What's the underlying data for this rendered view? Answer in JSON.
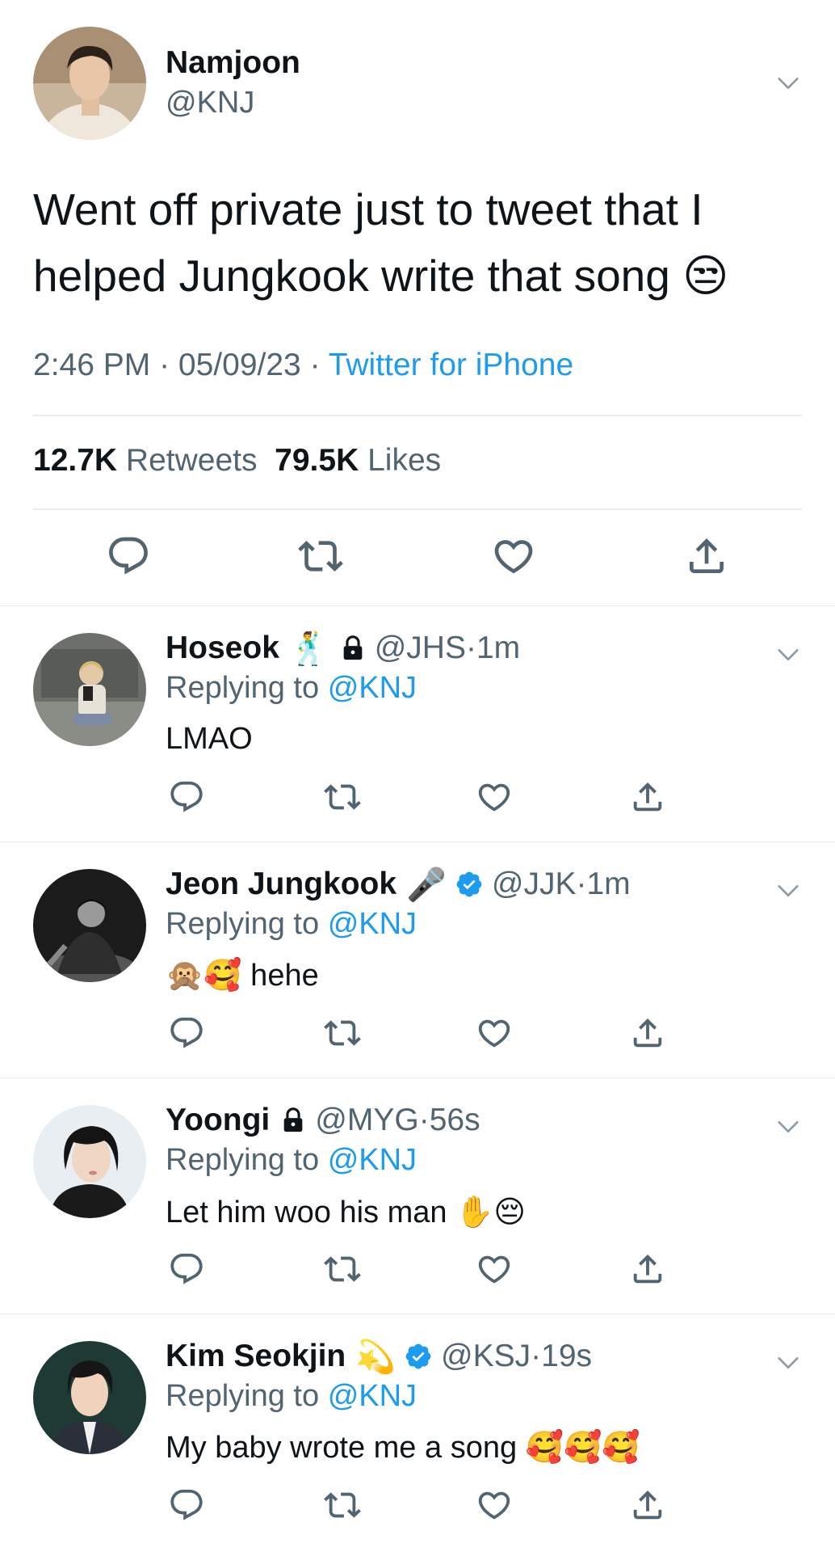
{
  "main_tweet": {
    "name": "Namjoon",
    "handle": "@KNJ",
    "text": "Went off private just to tweet that I helped Jungkook write that song 😒",
    "time": "2:46 PM",
    "date": "05/09/23",
    "source": "Twitter for iPhone",
    "retweets_count": "12.7K",
    "retweets_label": "Retweets",
    "likes_count": "79.5K",
    "likes_label": "Likes"
  },
  "replies": [
    {
      "name": "Hoseok",
      "name_emoji": "🕺",
      "locked": true,
      "verified": false,
      "handle": "@JHS",
      "time": "1m",
      "replying_prefix": "Replying to",
      "replying_to": "@KNJ",
      "text": "LMAO"
    },
    {
      "name": "Jeon Jungkook",
      "name_emoji": "🎤",
      "locked": false,
      "verified": true,
      "handle": "@JJK",
      "time": "1m",
      "replying_prefix": "Replying to",
      "replying_to": "@KNJ",
      "text": "🙊🥰 hehe"
    },
    {
      "name": "Yoongi",
      "name_emoji": "",
      "locked": true,
      "verified": false,
      "handle": "@MYG",
      "time": "56s",
      "replying_prefix": "Replying to",
      "replying_to": "@KNJ",
      "text": "Let him woo his man ✋😔"
    },
    {
      "name": "Kim Seokjin",
      "name_emoji": "💫",
      "locked": false,
      "verified": true,
      "handle": "@KSJ",
      "time": "19s",
      "replying_prefix": "Replying to",
      "replying_to": "@KNJ",
      "text": "My baby wrote me a song 🥰🥰🥰"
    }
  ],
  "colors": {
    "accent": "#1d9bf0",
    "secondary_text": "#536471",
    "divider": "#e6ecf0",
    "icon": "#536471"
  },
  "icons": [
    "chevron-down-icon",
    "reply-icon",
    "retweet-icon",
    "like-icon",
    "share-icon",
    "verified-badge-icon",
    "lock-icon"
  ]
}
